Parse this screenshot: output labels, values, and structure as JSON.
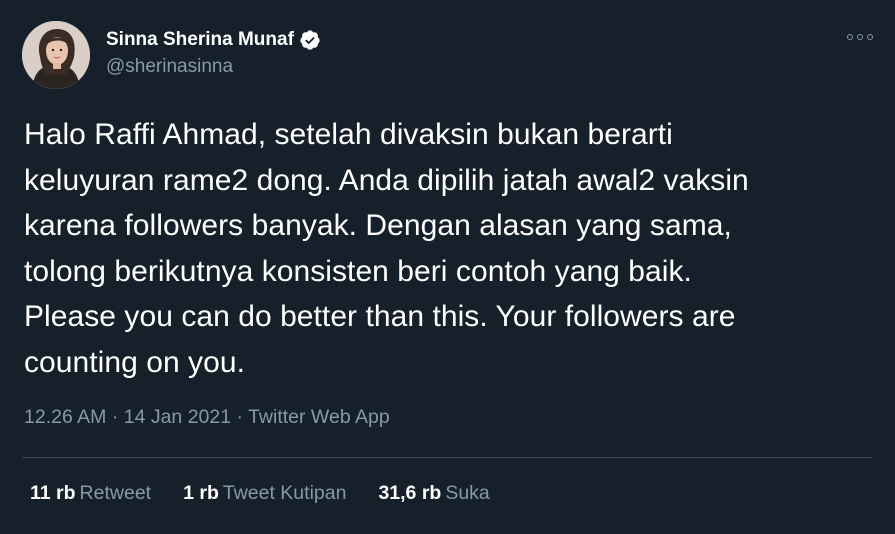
{
  "author": {
    "display_name": "Sinna Sherina Munaf",
    "handle": "@sherinasinna",
    "verified": true
  },
  "tweet": {
    "lines": [
      "Halo Raffi Ahmad, setelah divaksin bukan berarti",
      "keluyuran rame2 dong. Anda dipilih jatah awal2 vaksin",
      "karena followers banyak. Dengan alasan yang sama,",
      "tolong berikutnya konsisten beri contoh yang baik.",
      "Please you can do better than this. Your followers are",
      "counting on you."
    ],
    "time": "12.26 AM",
    "date": "14 Jan 2021",
    "source": "Twitter Web App",
    "separator": "·"
  },
  "stats": {
    "retweets": {
      "count": "11 rb",
      "label": "Retweet"
    },
    "quotes": {
      "count": "1 rb",
      "label": "Tweet Kutipan"
    },
    "likes": {
      "count": "31,6 rb",
      "label": "Suka"
    }
  },
  "icons": {
    "verified": "verified-badge-icon",
    "more": "more-options-icon"
  },
  "colors": {
    "background": "#15202b",
    "text": "#ffffff",
    "secondary": "#8899a6",
    "divider": "#38444d"
  }
}
